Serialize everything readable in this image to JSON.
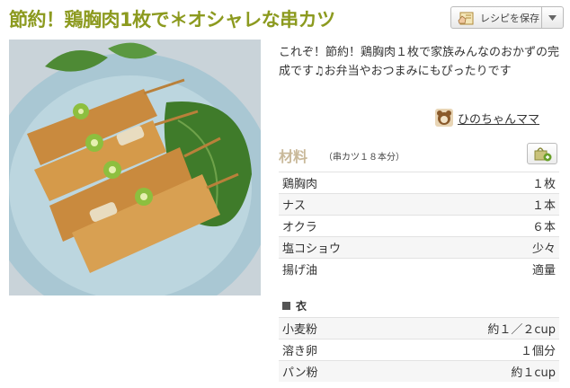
{
  "recipe": {
    "title": "節約！鶏胸肉1枚で＊オシャレな串カツ",
    "description": "これぞ！節約！鶏胸肉１枚で家族みんなのおかずの完成です♫お弁当やおつまみにもぴったりです",
    "author": "ひのちゃんママ"
  },
  "save": {
    "label": "レシピを保存",
    "icon": "save-recipe-icon",
    "dropdown_icon": "chevron-down-icon"
  },
  "ingredients": {
    "heading": "材料",
    "servings": "（串カツ１８本分）",
    "basket_icon": "add-to-basket-icon",
    "items": [
      {
        "name": "鶏胸肉",
        "qty": "１枚"
      },
      {
        "name": "ナス",
        "qty": "１本"
      },
      {
        "name": "オクラ",
        "qty": "６本"
      },
      {
        "name": "塩コショウ",
        "qty": "少々"
      },
      {
        "name": "揚げ油",
        "qty": "適量"
      }
    ],
    "group_name": "衣",
    "group_items": [
      {
        "name": "小麦粉",
        "qty": "約１／２cup"
      },
      {
        "name": "溶き卵",
        "qty": "１個分"
      },
      {
        "name": "パン粉",
        "qty": "約１cup"
      }
    ]
  },
  "colors": {
    "title": "#8c9a1f",
    "heading": "#c9b99a"
  }
}
